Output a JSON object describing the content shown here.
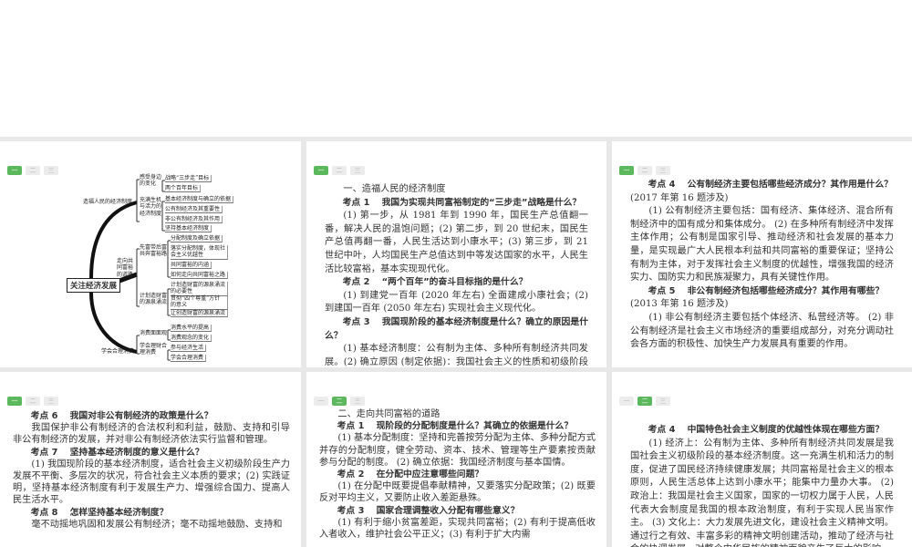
{
  "tabs": [
    "一",
    "二",
    "三"
  ],
  "mindmap": {
    "root": "关注经济发展",
    "branches": [
      {
        "label": "造福人民的经济制度",
        "subs": [
          {
            "label": "感受身边的变化",
            "leaves": [
              "战略“三步走”目标",
              "两个百年目标"
            ]
          },
          {
            "label": "充满生机与活力的经济制度",
            "leaves": [
              "基本经济制度与确立的依据",
              "公有制经济及其重要性",
              "非公有制经济及其作用",
              "坚持基本经济制度"
            ]
          }
        ]
      },
      {
        "label": "走向共同富裕的道路",
        "subs": [
          {
            "label": "先富带后富共奔富裕路",
            "leaves": [
              "分配制度及确立依据",
              "落实分配制度，体现社会主义优越性",
              "共同富裕的内涵",
              "如何走向共同富裕之路"
            ]
          },
          {
            "label": "计划造财富的源泉涌流",
            "leaves": [
              "计划造财富的源泉涌流的必要性",
              "贯彻“四个尊重”方针的意义",
              "让创造财富的源泉涌流"
            ]
          }
        ]
      },
      {
        "label": "学会合理消费",
        "subs": [
          {
            "label": "消费面面观",
            "leaves": [
              "消费水平的提高",
              "消费观念的变化"
            ]
          },
          {
            "label": "学会理财合理消费",
            "leaves": [
              "参与经济生活",
              "学会合理消费"
            ]
          }
        ]
      }
    ]
  },
  "p2": {
    "section": "一、造福人民的经济制度",
    "h1": "考点 1　 我国为实现共同富裕制定的“三步走”战略是什么？",
    "a1": "(1) 第一步，从 1981 年到 1990 年，国民生产总值翻一番，解决人民的温饱问题；(2) 第二步，到 20 世纪末，国民生产总值再翻一番，人民生活达到小康水平；(3) 第三步，到 21 世纪中叶，人均国民生产总值达到中等发达国家的水平，人民生活比较富裕，基本实现现代化。",
    "h2": "考点 2　 “两个百年”的奋斗目标指的是什么？",
    "a2": "(1) 到建党一百年 (2020 年左右) 全面建成小康社会；(2) 到建国一百年 (2050 年左右) 实现社会主义现代化。",
    "h3": "考点 3　 我国现阶段的基本经济制度是什么？确立的原因是什么？",
    "a3": "(1) 基本经济制度：公有制为主体、多种所有制经济共同发展。(2) 确立原因 (制定依据)：我国社会主义的性质和初级阶段的国"
  },
  "p3": {
    "h4": "考点 4　 公有制经济主要包括哪些经济成分？其作用是什么？",
    "n4": "(2017 年第 16 题涉及)",
    "a4": "(1) 公有制经济主要包括：国有经济、集体经济、混合所有制经济中的国有成分和集体成分。 (2) 在多种所有制经济中发挥主体作用；公有制是国家引导、推动经济和社会发展的基本力量，是实现最广大人民根本利益和共同富裕的重要保证；坚持公有制为主体，对于发挥社会主义制度的优越性，增强我国的经济实力、国防实力和民族凝聚力，具有关键性作用。",
    "h5": "考点 5　 非公有制经济包括哪些经济成分？其作用有哪些？",
    "n5": "(2013 年第 16 题涉及)",
    "a5": "(1) 非公有制经济主要包括个体经济、私营经济等。 (2) 非公有制经济是社会主义市场经济的重要组成部分，对充分调动社会各方面的积极性、加快生产力发展具有重要的作用。"
  },
  "p4": {
    "h6": "考点 6　 我国对非公有制经济的政策是什么？",
    "a6": "我国保护非公有制经济的合法权利和利益，鼓励、支持和引导非公有制经济的发展，并对非公有制经济依法实行监督和管理。",
    "h7": "考点 7　 坚持基本经济制度的意义是什么？",
    "a7": "(1) 我国现阶段的基本经济制度，适合社会主义初级阶段生产力发展不平衡、多层次的状况，符合社会主义本质的要求；(2) 实践证明，坚持基本经济制度有利于发展生产力、增强综合国力、提高人民生活水平。",
    "h8": "考点 8　 怎样坚持基本经济制度？",
    "a8": "毫不动摇地巩固和发展公有制经济；毫不动摇地鼓励、支持和"
  },
  "p5": {
    "section": "二、走向共同富裕的道路",
    "h1": "考点 1　 现阶段的分配制度是什么？其确立的依据是什么？",
    "a1": "(1) 基本分配制度：坚持和完善按劳分配为主体、多种分配方式并存的分配制度，健全劳动、资本、技术、管理等生产要素按贡献参与分配的制度。 (2) 确立依据：我国经济制度与基本国情。",
    "h2": "考点 2　 在分配中应注意哪些问题？",
    "a2": "(1) 在分配中既要提倡奉献精神，又要落实分配政策；(2) 既要反对平均主义，又要防止收入差距悬殊。",
    "h3": "考点 3　 国家合理调整收入分配有哪些意义？",
    "a3": "(1) 有利于缩小贫富差距，实现共同富裕；(2) 有利于提高低收入者收入，维护社会公平正义；(3) 有利于扩大内需"
  },
  "p6": {
    "h4": "考点 4　 中国特色社会主义制度的优越性体现在哪些方面？",
    "a4": "(1) 经济上：公有制为主体、多种所有制经济共同发展是我国社会主义初级阶段的基本经济制度。这一充满生机和活力的制度，促进了国民经济持续健康发展；共同富裕是社会主义的根本原则，人民生活总体上达到小康水平；能集中力量办大事。 (2) 政治上：我国是社会主义国家，国家的一切权力属于人民，人民代表大会制度是我国的根本政治制度，有利于实现人民当家作主。 (3) 文化上：大力发展先进文化，建设社会主义精神文明。通过行之有效、丰富多彩的精神文明创建活动，推动了经济与社会的协调发展，对整个中华民族的精神面貌产生了巨大的影响。"
  }
}
